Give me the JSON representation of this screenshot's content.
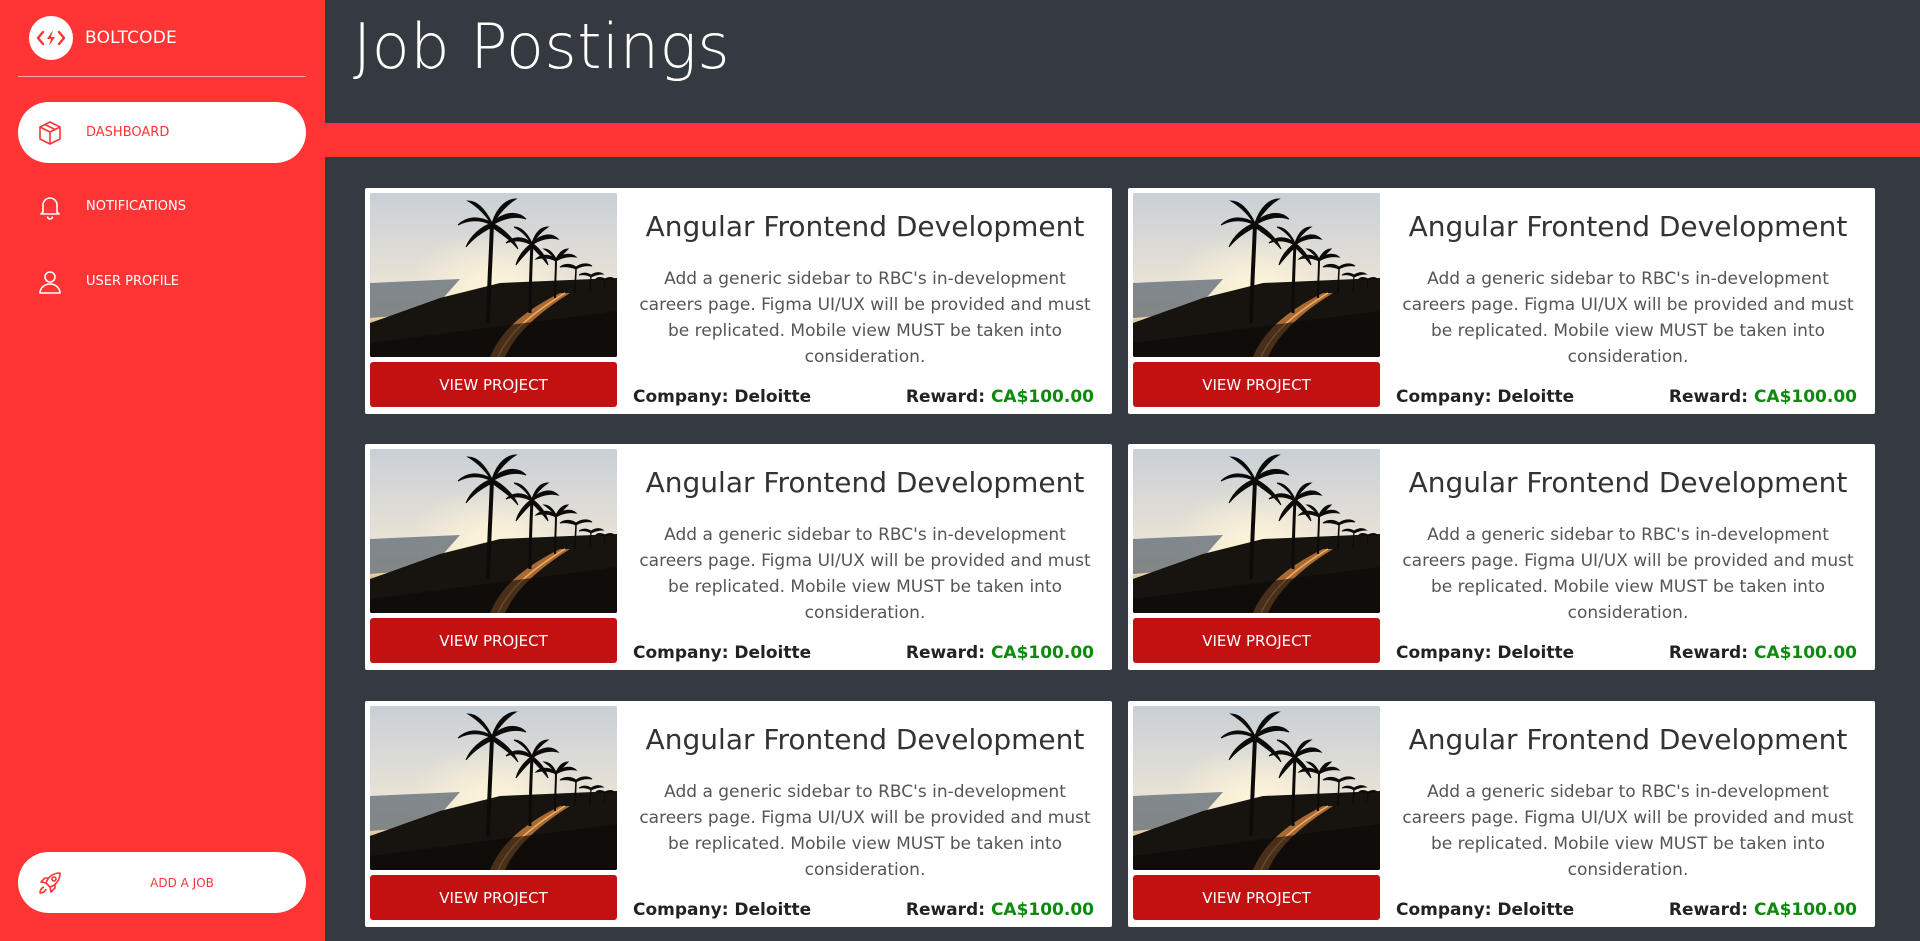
{
  "brand": {
    "name": "BOLTCODE"
  },
  "nav": {
    "items": [
      {
        "label": "DASHBOARD",
        "icon": "box-icon",
        "active": true
      },
      {
        "label": "NOTIFICATIONS",
        "icon": "bell-icon",
        "active": false
      },
      {
        "label": "USER PROFILE",
        "icon": "user-icon",
        "active": false
      }
    ],
    "add_job": {
      "label": "ADD A JOB",
      "icon": "rocket-icon"
    }
  },
  "header": {
    "title": "Job Postings"
  },
  "colors": {
    "accent": "#ff3434",
    "button": "#c31010",
    "reward": "#0f8a0f",
    "background": "#353a40"
  },
  "cards": [
    {
      "title": "Angular Frontend Development",
      "description": "Add a generic sidebar to RBC's in-development careers page. Figma UI/UX will be provided and must be replicated. Mobile view MUST be taken into consideration.",
      "button_label": "VIEW PROJECT",
      "company_label": "Company: Deloitte",
      "reward_label": "Reward:",
      "reward_value": "CA$100.00"
    },
    {
      "title": "Angular Frontend Development",
      "description": "Add a generic sidebar to RBC's in-development careers page. Figma UI/UX will be provided and must be replicated. Mobile view MUST be taken into consideration.",
      "button_label": "VIEW PROJECT",
      "company_label": "Company: Deloitte",
      "reward_label": "Reward:",
      "reward_value": "CA$100.00"
    },
    {
      "title": "Angular Frontend Development",
      "description": "Add a generic sidebar to RBC's in-development careers page. Figma UI/UX will be provided and must be replicated. Mobile view MUST be taken into consideration.",
      "button_label": "VIEW PROJECT",
      "company_label": "Company: Deloitte",
      "reward_label": "Reward:",
      "reward_value": "CA$100.00"
    },
    {
      "title": "Angular Frontend Development",
      "description": "Add a generic sidebar to RBC's in-development careers page. Figma UI/UX will be provided and must be replicated. Mobile view MUST be taken into consideration.",
      "button_label": "VIEW PROJECT",
      "company_label": "Company: Deloitte",
      "reward_label": "Reward:",
      "reward_value": "CA$100.00"
    },
    {
      "title": "Angular Frontend Development",
      "description": "Add a generic sidebar to RBC's in-development careers page. Figma UI/UX will be provided and must be replicated. Mobile view MUST be taken into consideration.",
      "button_label": "VIEW PROJECT",
      "company_label": "Company: Deloitte",
      "reward_label": "Reward:",
      "reward_value": "CA$100.00"
    },
    {
      "title": "Angular Frontend Development",
      "description": "Add a generic sidebar to RBC's in-development careers page. Figma UI/UX will be provided and must be replicated. Mobile view MUST be taken into consideration.",
      "button_label": "VIEW PROJECT",
      "company_label": "Company: Deloitte",
      "reward_label": "Reward:",
      "reward_value": "CA$100.00"
    }
  ]
}
